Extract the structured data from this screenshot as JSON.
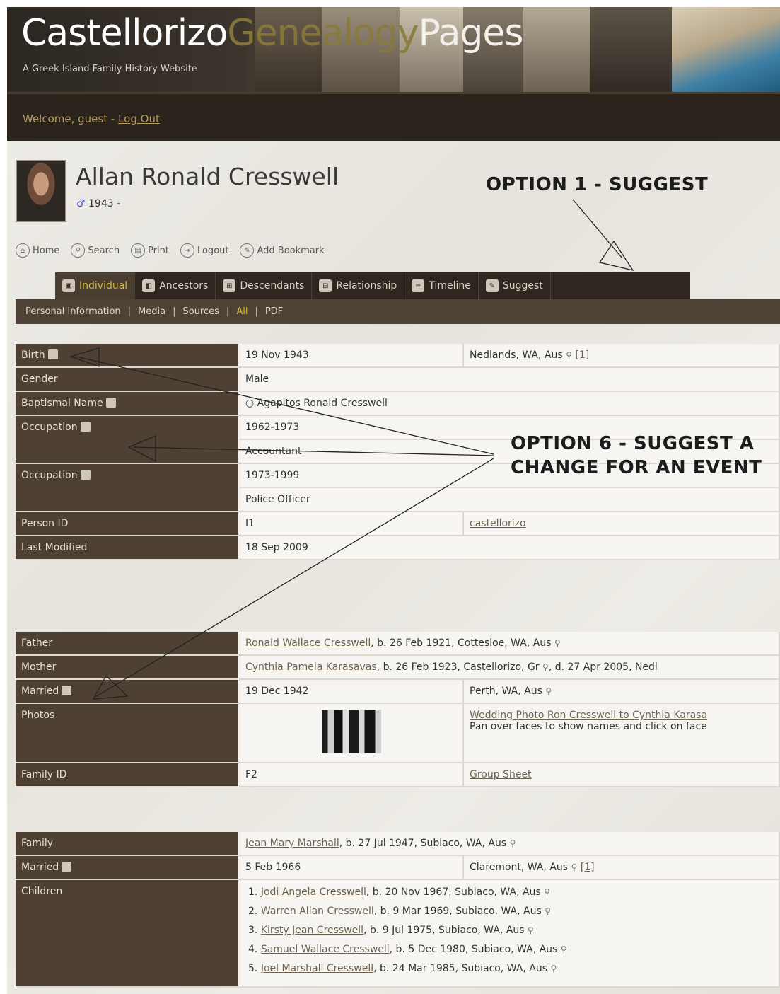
{
  "site": {
    "title_part1": "Castellorizo",
    "title_part2": "Genealogy",
    "title_part3": "Pages",
    "subtitle": "A Greek Island Family History Website",
    "welcome": "Welcome, guest -",
    "logout_link": "Log Out"
  },
  "person": {
    "name": "Allan Ronald Cresswell",
    "gender_symbol": "♂",
    "years": "1943 -"
  },
  "toolbar": [
    {
      "label": "Home",
      "icon": "home-icon"
    },
    {
      "label": "Search",
      "icon": "search-icon"
    },
    {
      "label": "Print",
      "icon": "print-icon"
    },
    {
      "label": "Logout",
      "icon": "logout-icon"
    },
    {
      "label": "Add Bookmark",
      "icon": "bookmark-icon"
    }
  ],
  "tabs": [
    {
      "label": "Individual",
      "active": true
    },
    {
      "label": "Ancestors"
    },
    {
      "label": "Descendants"
    },
    {
      "label": "Relationship"
    },
    {
      "label": "Timeline"
    },
    {
      "label": "Suggest"
    }
  ],
  "subnav": [
    "Personal Information",
    "Media",
    "Sources",
    "All",
    "PDF"
  ],
  "individual": {
    "birth_label": "Birth",
    "birth_date": "19 Nov 1943",
    "birth_place": "Nedlands, WA, Aus",
    "birth_source": "[1]",
    "gender_label": "Gender",
    "gender": "Male",
    "baptismal_label": "Baptismal Name",
    "baptismal": "Agapitos Ronald Cresswell",
    "occ1_label": "Occupation",
    "occ1_years": "1962-1973",
    "occ1_title": "Accountant",
    "occ2_label": "Occupation",
    "occ2_years": "1973-1999",
    "occ2_title": "Police Officer",
    "pid_label": "Person ID",
    "pid": "I1",
    "pid_tree": "castellorizo",
    "modified_label": "Last Modified",
    "modified": "18 Sep 2009"
  },
  "parents": {
    "father_label": "Father",
    "father_name": "Ronald Wallace Cresswell",
    "father_info": ", b. 26 Feb 1921, Cottesloe, WA, Aus",
    "mother_label": "Mother",
    "mother_name": "Cynthia Pamela Karasavas",
    "mother_info": ", b. 26 Feb 1923, Castellorizo, Gr",
    "mother_death": ", d. 27 Apr 2005, Nedl",
    "married_label": "Married",
    "married_date": "19 Dec 1942",
    "married_place": "Perth, WA, Aus",
    "photos_label": "Photos",
    "photo_link": "Wedding Photo Ron Cresswell to Cynthia Karasa",
    "photo_caption": "Pan over faces to show names and click on face",
    "famid_label": "Family ID",
    "famid": "F2",
    "group_sheet": "Group Sheet"
  },
  "family": {
    "family_label": "Family",
    "spouse_name": "Jean Mary Marshall",
    "spouse_info": ", b. 27 Jul 1947, Subiaco, WA, Aus",
    "married_label": "Married",
    "married_date": "5 Feb 1966",
    "married_place": "Claremont, WA, Aus",
    "married_source": "[1]",
    "children_label": "Children",
    "children": [
      {
        "num": "1.",
        "name": "Jodi Angela Cresswell",
        "info": ", b. 20 Nov 1967, Subiaco, WA, Aus"
      },
      {
        "num": "2.",
        "name": "Warren Allan Cresswell",
        "info": ", b. 9 Mar 1969, Subiaco, WA, Aus"
      },
      {
        "num": "3.",
        "name": "Kirsty Jean Cresswell",
        "info": ", b. 9 Jul 1975, Subiaco, WA, Aus"
      },
      {
        "num": "4.",
        "name": "Samuel Wallace Cresswell",
        "info": ", b. 5 Dec 1980, Subiaco, WA, Aus"
      },
      {
        "num": "5.",
        "name": "Joel Marshall Cresswell",
        "info": ", b. 24 Mar 1985, Subiaco, WA, Aus"
      }
    ]
  },
  "annotations": {
    "option1": "OPTION 1 - SUGGEST",
    "option6_line1": "OPTION 6 - SUGGEST A",
    "option6_line2": "CHANGE FOR AN EVENT"
  }
}
